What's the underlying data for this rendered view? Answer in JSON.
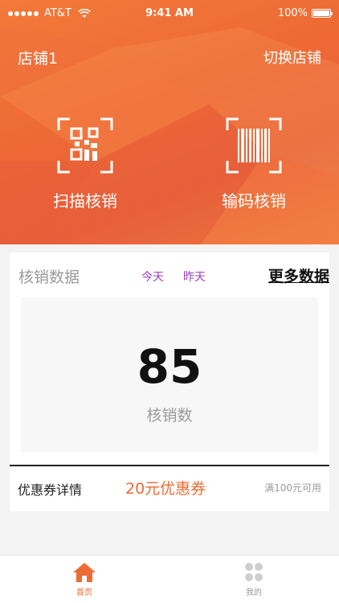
{
  "status_bar": {
    "carrier": "AT&T",
    "time": "9:41 AM",
    "battery": "100%"
  },
  "header": {
    "store_name": "店铺1",
    "switch_store": "切换店铺"
  },
  "actions": {
    "scan_label": "扫描核销",
    "input_label": "输码核销"
  },
  "stats": {
    "title": "核销数据",
    "tab_today": "今天",
    "tab_yesterday": "昨天",
    "more_link": "更多数据",
    "value": "85",
    "value_label": "核销数"
  },
  "coupon": {
    "title": "优惠券详情",
    "name": "20元优惠券",
    "condition": "满100元可用"
  },
  "tabbar": {
    "home_label": "首页",
    "mine_label": "我的",
    "active": "home"
  },
  "colors": {
    "brand": "#ee6b34",
    "tab_text": "#a040c0",
    "inactive_icon": "#cfcfcf"
  }
}
